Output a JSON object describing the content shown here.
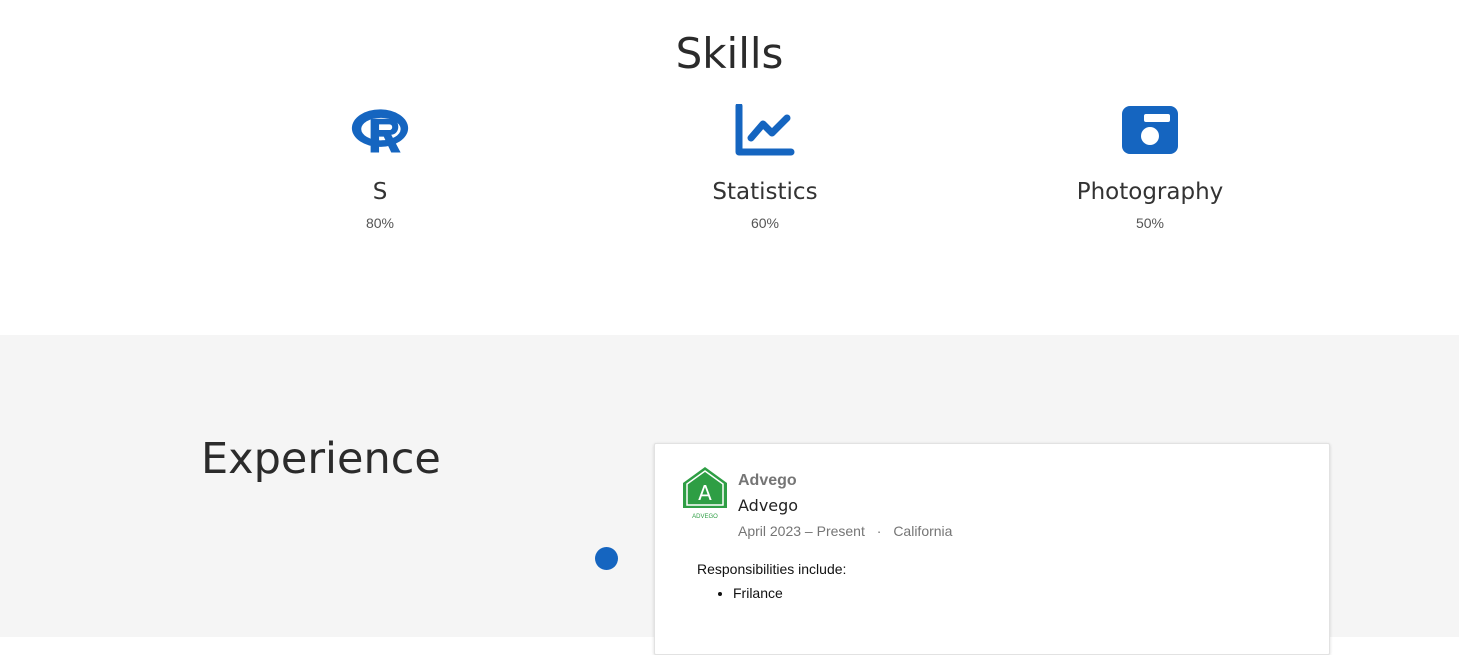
{
  "skills": {
    "title": "Skills",
    "items": [
      {
        "name": "S",
        "level": "80%",
        "icon": "r-language-icon"
      },
      {
        "name": "Statistics",
        "level": "60%",
        "icon": "chart-line-icon"
      },
      {
        "name": "Photography",
        "level": "50%",
        "icon": "camera-icon"
      }
    ]
  },
  "experience": {
    "title": "Experience",
    "entries": [
      {
        "company": "Advego",
        "role": "Advego",
        "dates": "April 2023 – Present",
        "separator": "·",
        "location": "California",
        "responsibilities_label": "Responsibilities include:",
        "responsibilities": [
          "Frilance"
        ],
        "logo_icon": "advego-logo-icon",
        "logo_letter": "A",
        "logo_caption": "ADVEGO"
      }
    ]
  },
  "colors": {
    "accent": "#1565c0",
    "logo_green": "#2e9e44",
    "experience_bg": "#f5f5f5"
  }
}
